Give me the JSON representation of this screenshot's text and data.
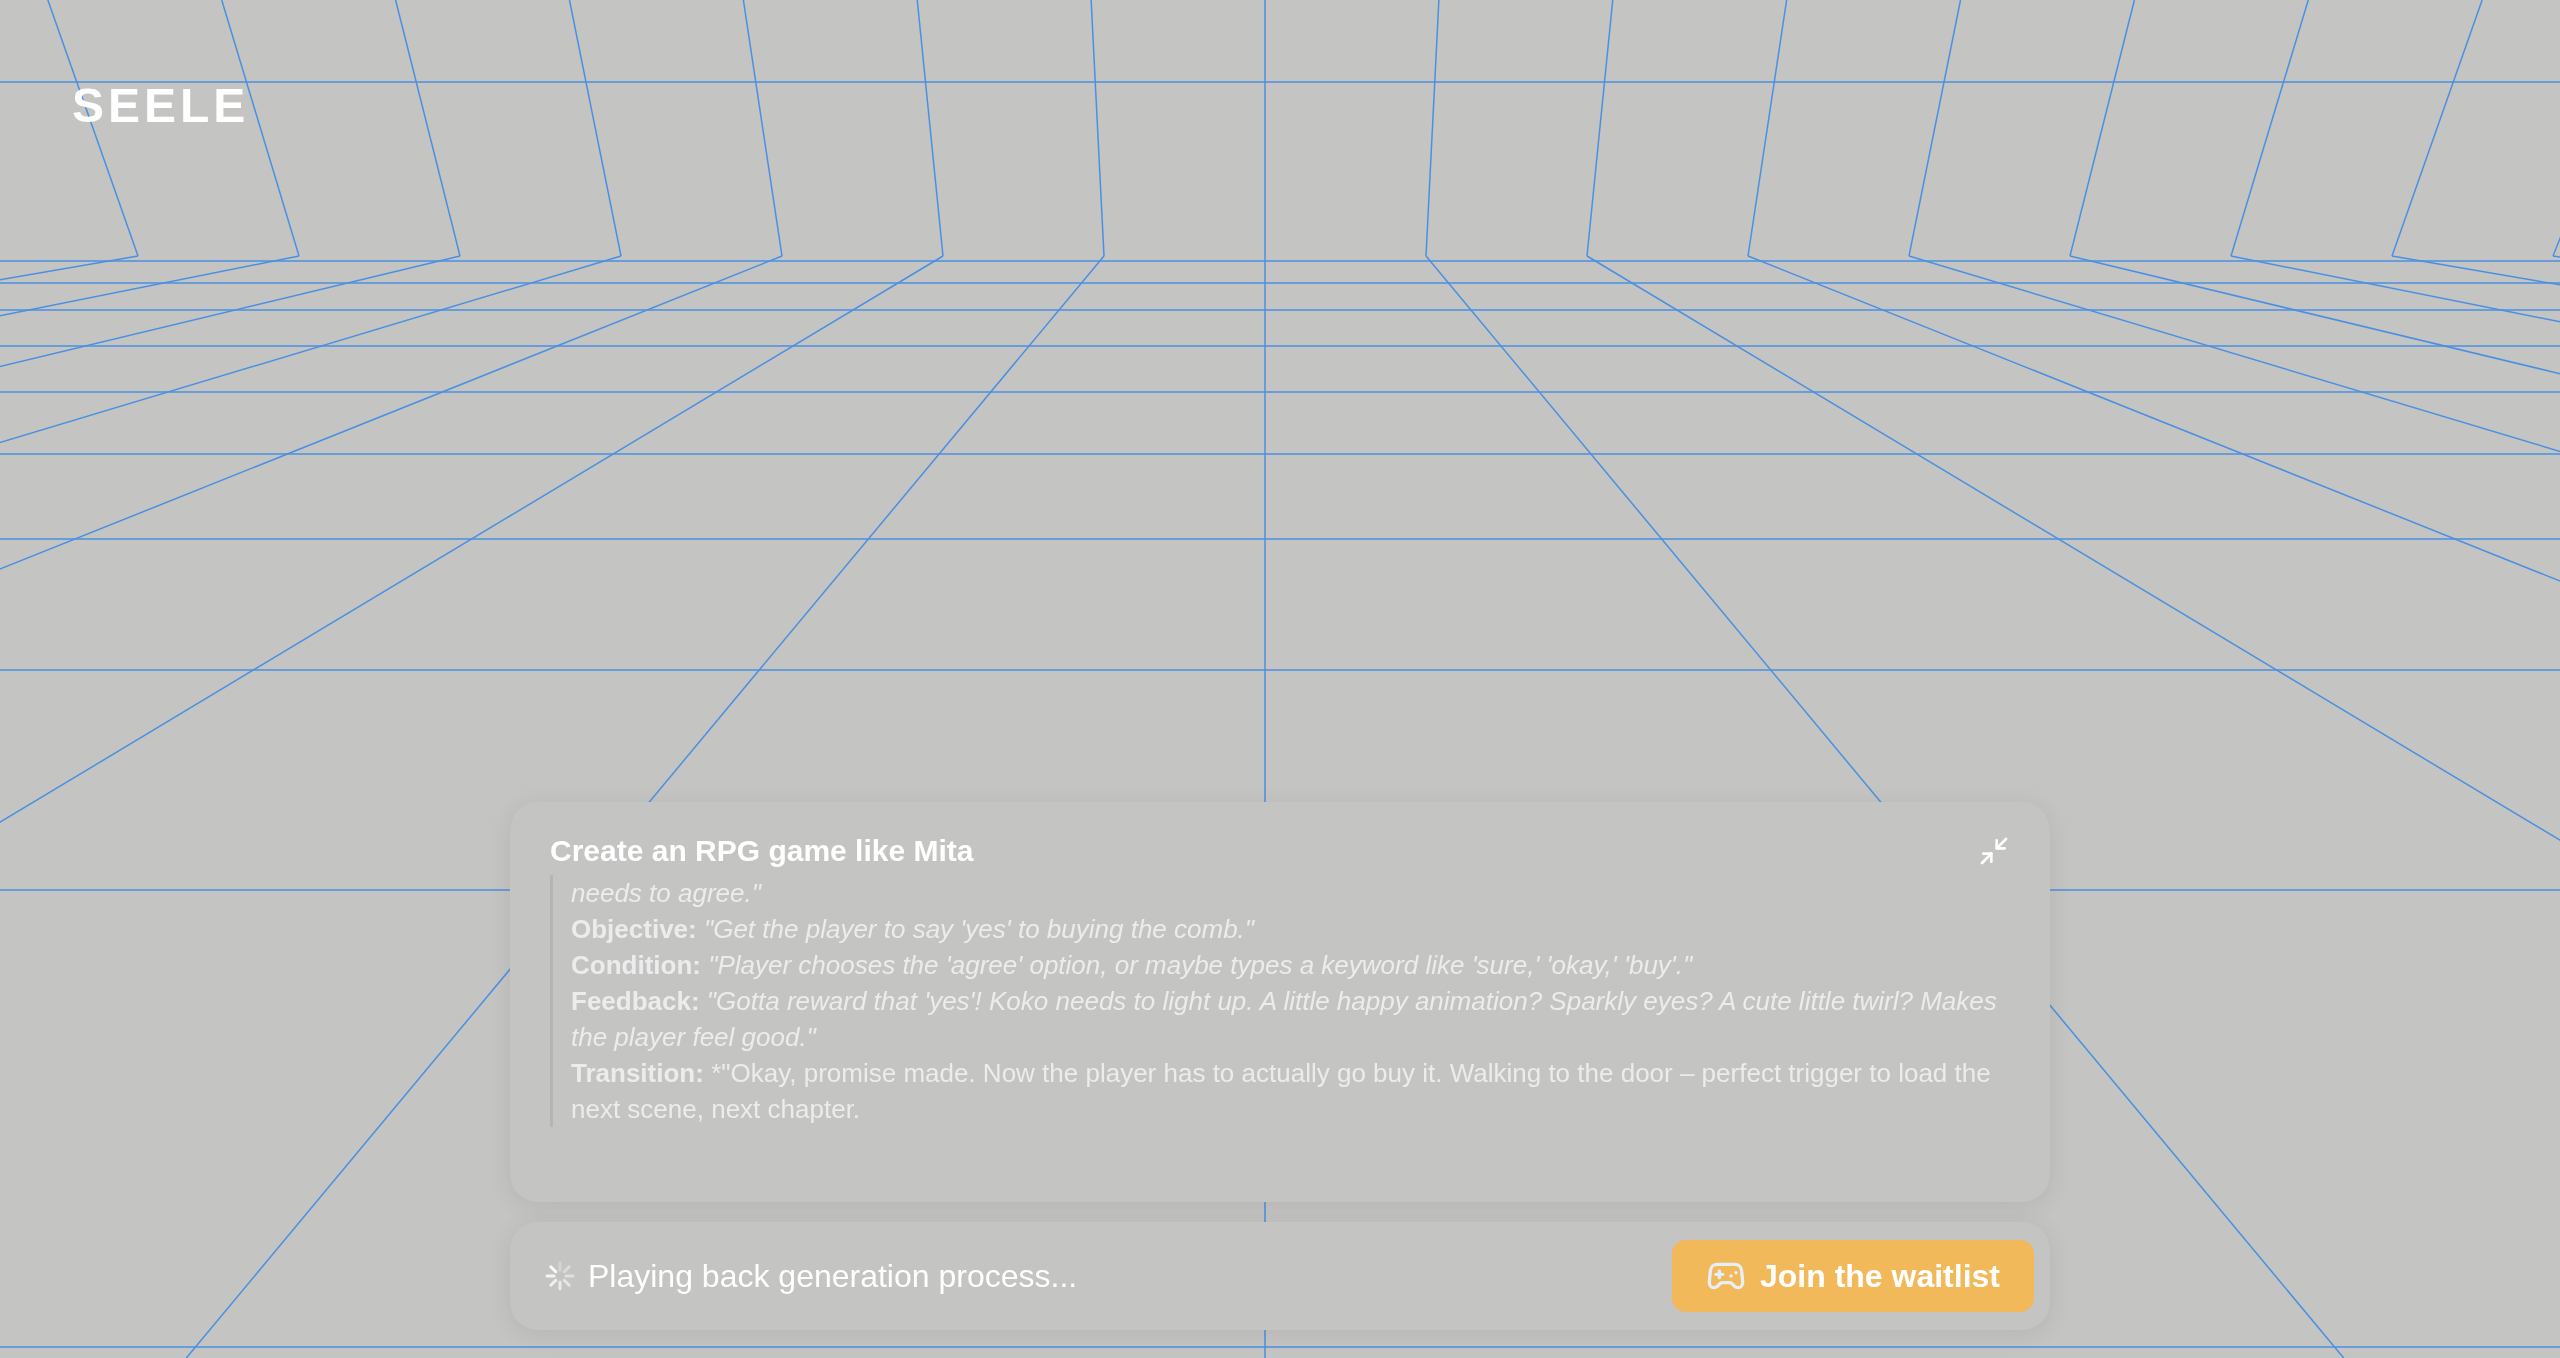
{
  "logo": "SEELE",
  "card": {
    "title": "Create an RPG game like Mita",
    "lines": [
      "*needs to agree.\"*",
      "**Objective:** *\"Get the player to say 'yes' to buying the comb.\"*",
      "**Condition:** *\"Player chooses the 'agree' option, or maybe types a keyword like 'sure,' 'okay,' 'buy'.\"*",
      "**Feedback:** *\"Gotta reward that 'yes'! Koko needs to light up. A little happy animation? Sparkly eyes? A cute little twirl? Makes the player feel good.\"*",
      "**Transition:** *\"Okay, promise made. Now the player has to actually go buy it. Walking to the door – perfect trigger to load the next scene, next chapter."
    ]
  },
  "status": {
    "text": "Playing back generation process...",
    "button": "Join the waitlist"
  }
}
